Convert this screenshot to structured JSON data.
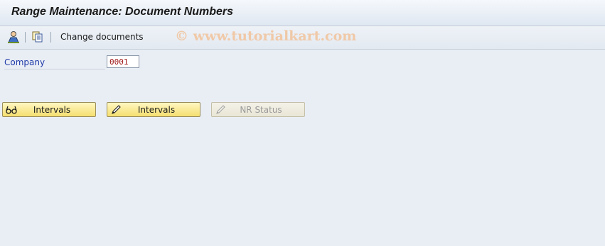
{
  "window": {
    "title": "Range Maintenance: Document Numbers"
  },
  "toolbar": {
    "items": [
      {
        "icon": "user-settings-icon"
      },
      {
        "icon": "copy-documents-icon"
      }
    ],
    "change_documents_label": "Change documents",
    "watermark": "© www.tutorialkart.com"
  },
  "form": {
    "company_label": "Company",
    "company_value": "0001"
  },
  "buttons": [
    {
      "label": "Intervals",
      "icon": "glasses-icon",
      "enabled": true
    },
    {
      "label": "Intervals",
      "icon": "pencil-icon",
      "enabled": true
    },
    {
      "label": "NR Status",
      "icon": "pencil-icon",
      "enabled": false
    }
  ],
  "colors": {
    "background": "#e9eef5",
    "label_blue": "#1f3aa8",
    "input_value_red": "#a01818",
    "button_yellow": "#f5df6f",
    "watermark": "#f0c9a8"
  }
}
